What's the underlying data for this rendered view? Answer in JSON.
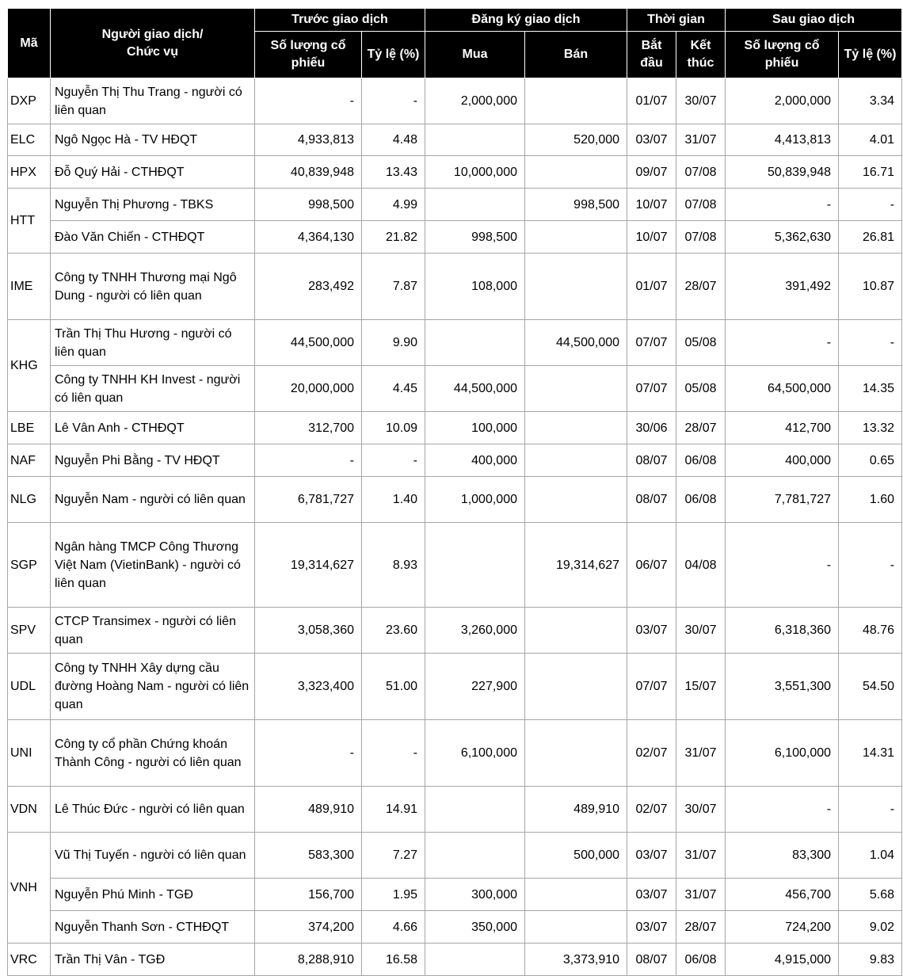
{
  "headers": {
    "ma": "Mã",
    "nguoi_giao_dich": "Người giao dịch/\nChức vụ",
    "truoc_giao_dich": "Trước giao dịch",
    "dang_ky_giao_dich": "Đăng ký giao dịch",
    "thoi_gian": "Thời gian",
    "sau_giao_dich": "Sau giao dịch",
    "so_luong_co_phieu": "Số lượng cổ phiếu",
    "ty_le": "Tỷ lệ (%)",
    "mua": "Mua",
    "ban": "Bán",
    "bat_dau": "Bắt đầu",
    "ket_thuc": "Kết thúc"
  },
  "rows": [
    {
      "code": "DXP",
      "name": "Nguyễn Thị Thu Trang - người có liên quan",
      "before_qty": "-",
      "before_pct": "-",
      "buy": "2,000,000",
      "sell": "",
      "start": "01/07",
      "end": "30/07",
      "after_qty": "2,000,000",
      "after_pct": "3.34"
    },
    {
      "code": "ELC",
      "name": "Ngô Ngọc Hà - TV HĐQT",
      "before_qty": "4,933,813",
      "before_pct": "4.48",
      "buy": "",
      "sell": "520,000",
      "start": "03/07",
      "end": "31/07",
      "after_qty": "4,413,813",
      "after_pct": "4.01"
    },
    {
      "code": "HPX",
      "name": "Đỗ Quý Hải - CTHĐQT",
      "before_qty": "40,839,948",
      "before_pct": "13.43",
      "buy": "10,000,000",
      "sell": "",
      "start": "09/07",
      "end": "07/08",
      "after_qty": "50,839,948",
      "after_pct": "16.71"
    },
    {
      "code": "HTT",
      "name": "Nguyễn Thị Phương - TBKS",
      "before_qty": "998,500",
      "before_pct": "4.99",
      "buy": "",
      "sell": "998,500",
      "start": "10/07",
      "end": "07/08",
      "after_qty": "-",
      "after_pct": "-"
    },
    {
      "code": "",
      "name": "Đào Văn Chiến - CTHĐQT",
      "before_qty": "4,364,130",
      "before_pct": "21.82",
      "buy": "998,500",
      "sell": "",
      "start": "10/07",
      "end": "07/08",
      "after_qty": "5,362,630",
      "after_pct": "26.81"
    },
    {
      "code": "IME",
      "name": "Công ty TNHH Thương mại Ngô Dung - người có liên quan",
      "before_qty": "283,492",
      "before_pct": "7.87",
      "buy": "108,000",
      "sell": "",
      "start": "01/07",
      "end": "28/07",
      "after_qty": "391,492",
      "after_pct": "10.87"
    },
    {
      "code": "KHG",
      "name": "Trần Thị Thu Hương  - người có liên quan",
      "before_qty": "44,500,000",
      "before_pct": "9.90",
      "buy": "",
      "sell": "44,500,000",
      "start": "07/07",
      "end": "05/08",
      "after_qty": "-",
      "after_pct": "-"
    },
    {
      "code": "",
      "name": "Công ty TNHH KH Invest - người có liên quan",
      "before_qty": "20,000,000",
      "before_pct": "4.45",
      "buy": "44,500,000",
      "sell": "",
      "start": "07/07",
      "end": "05/08",
      "after_qty": "64,500,000",
      "after_pct": "14.35"
    },
    {
      "code": "LBE",
      "name": "Lê Vân Anh - CTHĐQT",
      "before_qty": "312,700",
      "before_pct": "10.09",
      "buy": "100,000",
      "sell": "",
      "start": "30/06",
      "end": "28/07",
      "after_qty": "412,700",
      "after_pct": "13.32"
    },
    {
      "code": "NAF",
      "name": "Nguyễn Phi Bằng - TV HĐQT",
      "before_qty": "-",
      "before_pct": "-",
      "buy": "400,000",
      "sell": "",
      "start": "08/07",
      "end": "06/08",
      "after_qty": "400,000",
      "after_pct": "0.65"
    },
    {
      "code": "NLG",
      "name": "Nguyễn Nam - người có liên quan",
      "before_qty": "6,781,727",
      "before_pct": "1.40",
      "buy": "1,000,000",
      "sell": "",
      "start": "08/07",
      "end": "06/08",
      "after_qty": "7,781,727",
      "after_pct": "1.60"
    },
    {
      "code": "SGP",
      "name": "Ngân hàng TMCP Công Thương Việt Nam (VietinBank) - người có liên quan",
      "before_qty": "19,314,627",
      "before_pct": "8.93",
      "buy": "",
      "sell": "19,314,627",
      "start": "06/07",
      "end": "04/08",
      "after_qty": "-",
      "after_pct": "-"
    },
    {
      "code": "SPV",
      "name": "CTCP Transimex - người có liên quan",
      "before_qty": "3,058,360",
      "before_pct": "23.60",
      "buy": "3,260,000",
      "sell": "",
      "start": "03/07",
      "end": "30/07",
      "after_qty": "6,318,360",
      "after_pct": "48.76"
    },
    {
      "code": "UDL",
      "name": "Công ty TNHH Xây dựng cầu đường Hoàng Nam - người có liên quan",
      "before_qty": "3,323,400",
      "before_pct": "51.00",
      "buy": "227,900",
      "sell": "",
      "start": "07/07",
      "end": "15/07",
      "after_qty": "3,551,300",
      "after_pct": "54.50"
    },
    {
      "code": "UNI",
      "name": "Công ty cổ phần Chứng khoán Thành Công - người có liên quan",
      "before_qty": "-",
      "before_pct": "-",
      "buy": "6,100,000",
      "sell": "",
      "start": "02/07",
      "end": "31/07",
      "after_qty": "6,100,000",
      "after_pct": "14.31"
    },
    {
      "code": "VDN",
      "name": "Lê Thúc Đức - người có liên quan",
      "before_qty": "489,910",
      "before_pct": "14.91",
      "buy": "",
      "sell": "489,910",
      "start": "02/07",
      "end": "30/07",
      "after_qty": "-",
      "after_pct": "-"
    },
    {
      "code": "VNH",
      "name": "Vũ Thị Tuyến - người có liên quan",
      "before_qty": "583,300",
      "before_pct": "7.27",
      "buy": "",
      "sell": "500,000",
      "start": "03/07",
      "end": "31/07",
      "after_qty": "83,300",
      "after_pct": "1.04"
    },
    {
      "code": "",
      "name": "Nguyễn Phú Minh - TGĐ",
      "before_qty": "156,700",
      "before_pct": "1.95",
      "buy": "300,000",
      "sell": "",
      "start": "03/07",
      "end": "31/07",
      "after_qty": "456,700",
      "after_pct": "5.68"
    },
    {
      "code": "",
      "name": "Nguyễn Thanh Sơn - CTHĐQT",
      "before_qty": "374,200",
      "before_pct": "4.66",
      "buy": "350,000",
      "sell": "",
      "start": "03/07",
      "end": "28/07",
      "after_qty": "724,200",
      "after_pct": "9.02"
    },
    {
      "code": "VRC",
      "name": "Trần Thị Vân - TGĐ",
      "before_qty": "8,288,910",
      "before_pct": "16.58",
      "buy": "",
      "sell": "3,373,910",
      "start": "08/07",
      "end": "06/08",
      "after_qty": "4,915,000",
      "after_pct": "9.83"
    }
  ]
}
